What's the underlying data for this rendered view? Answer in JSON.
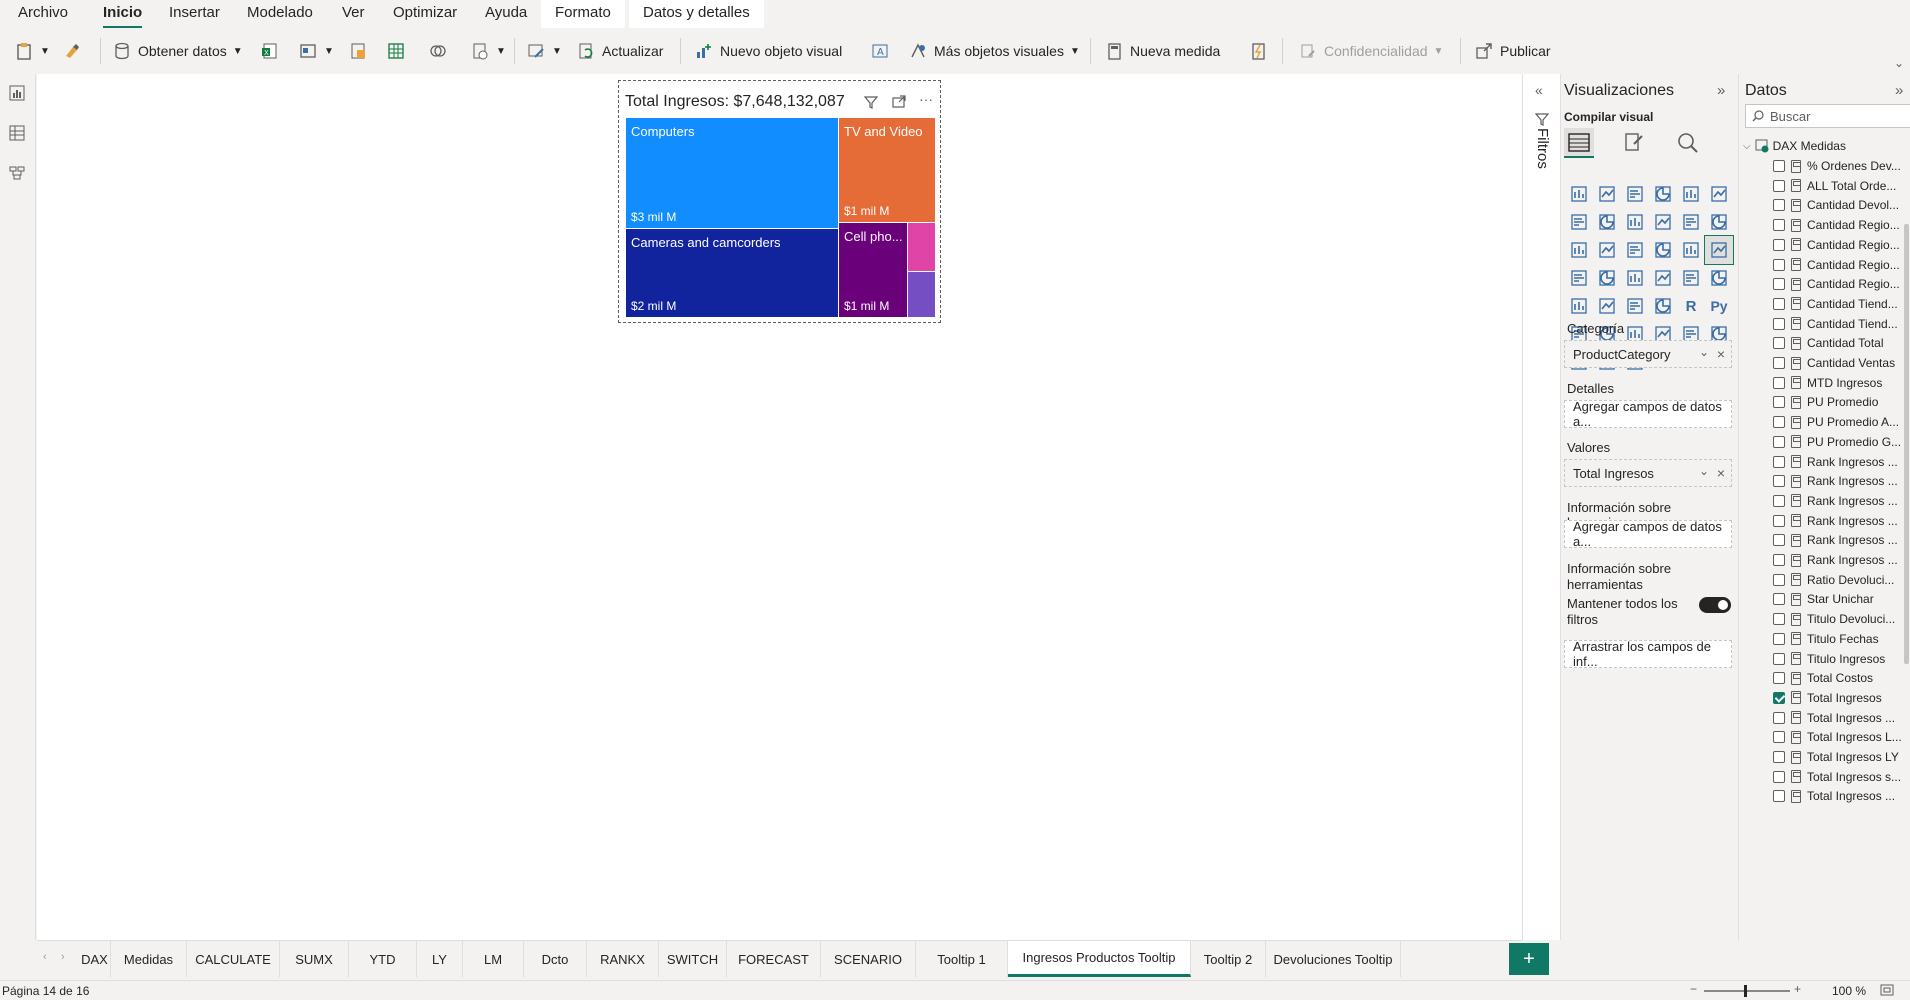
{
  "ribbon": {
    "tabs": [
      "Archivo",
      "Inicio",
      "Insertar",
      "Modelado",
      "Ver",
      "Optimizar",
      "Ayuda",
      "Formato",
      "Datos y detalles"
    ],
    "active_tab": "Inicio",
    "buttons": {
      "obtener_datos": "Obtener datos",
      "actualizar": "Actualizar",
      "nuevo_objeto_visual": "Nuevo objeto visual",
      "mas_objetos_visuales": "Más objetos visuales",
      "nueva_medida": "Nueva medida",
      "confidencialidad": "Confidencialidad",
      "publicar": "Publicar"
    }
  },
  "visual": {
    "title": "Total Ingresos: $7,648,132,087",
    "tiles": [
      {
        "label": "Computers",
        "value": "$3 mil M",
        "color": "#118dff"
      },
      {
        "label": "TV and Video",
        "value": "$1 mil M",
        "color": "#e66c37"
      },
      {
        "label": "Cameras and camcorders",
        "value": "$2 mil M",
        "color": "#12239e"
      },
      {
        "label": "Cell pho...",
        "value": "$1 mil M",
        "color": "#6b007b"
      }
    ],
    "small_colors": [
      "#e044a7",
      "#744ec2"
    ]
  },
  "filters_label": "Filtros",
  "viz_pane": {
    "title": "Visualizaciones",
    "build_label": "Compilar visual",
    "wells": {
      "categoria_label": "Categoría",
      "categoria_value": "ProductCategory",
      "detalles_label": "Detalles",
      "detalles_placeholder": "Agregar campos de datos a...",
      "valores_label": "Valores",
      "valores_value": "Total Ingresos",
      "info_label": "Información sobre herramien...",
      "info_placeholder": "Agregar campos de datos a...",
      "tooltip_label": "Información sobre herramientas",
      "keep_filters_label": "Mantener todos los filtros",
      "drag_placeholder": "Arrastrar los campos de inf..."
    }
  },
  "data_pane": {
    "title": "Datos",
    "search_placeholder": "Buscar",
    "table_name": "DAX Medidas",
    "fields": [
      {
        "name": "% Ordenes Dev...",
        "checked": false
      },
      {
        "name": "ALL Total Orde...",
        "checked": false
      },
      {
        "name": "Cantidad Devol...",
        "checked": false
      },
      {
        "name": "Cantidad Regio...",
        "checked": false
      },
      {
        "name": "Cantidad Regio...",
        "checked": false
      },
      {
        "name": "Cantidad Regio...",
        "checked": false
      },
      {
        "name": "Cantidad Regio...",
        "checked": false
      },
      {
        "name": "Cantidad Tiend...",
        "checked": false
      },
      {
        "name": "Cantidad Tiend...",
        "checked": false
      },
      {
        "name": "Cantidad Total",
        "checked": false
      },
      {
        "name": "Cantidad Ventas",
        "checked": false
      },
      {
        "name": "MTD Ingresos",
        "checked": false
      },
      {
        "name": "PU Promedio",
        "checked": false
      },
      {
        "name": "PU Promedio A...",
        "checked": false
      },
      {
        "name": "PU Promedio G...",
        "checked": false
      },
      {
        "name": "Rank Ingresos ...",
        "checked": false
      },
      {
        "name": "Rank Ingresos ...",
        "checked": false
      },
      {
        "name": "Rank Ingresos ...",
        "checked": false
      },
      {
        "name": "Rank Ingresos ...",
        "checked": false
      },
      {
        "name": "Rank Ingresos ...",
        "checked": false
      },
      {
        "name": "Rank Ingresos ...",
        "checked": false
      },
      {
        "name": "Ratio Devoluci...",
        "checked": false
      },
      {
        "name": "Star Unichar",
        "checked": false
      },
      {
        "name": "Titulo Devoluci...",
        "checked": false
      },
      {
        "name": "Titulo Fechas",
        "checked": false
      },
      {
        "name": "Titulo Ingresos",
        "checked": false
      },
      {
        "name": "Total Costos",
        "checked": false
      },
      {
        "name": "Total Ingresos",
        "checked": true
      },
      {
        "name": "Total Ingresos ...",
        "checked": false
      },
      {
        "name": "Total Ingresos L...",
        "checked": false
      },
      {
        "name": "Total Ingresos LY",
        "checked": false
      },
      {
        "name": "Total Ingresos s...",
        "checked": false
      },
      {
        "name": "Total Ingresos ...",
        "checked": false
      }
    ]
  },
  "page_tabs": [
    "DAX",
    "Medidas",
    "CALCULATE",
    "SUMX",
    "YTD",
    "LY",
    "LM",
    "Dcto",
    "RANKX",
    "SWITCH",
    "FORECAST",
    "SCENARIO",
    "Tooltip 1",
    "Ingresos Productos Tooltip",
    "Tooltip 2",
    "Devoluciones Tooltip"
  ],
  "active_page": "Ingresos Productos Tooltip",
  "add_page": "+",
  "status": {
    "page_info": "Página 14 de 16",
    "zoom": "100 %"
  },
  "colors": {
    "accent": "#117865"
  }
}
